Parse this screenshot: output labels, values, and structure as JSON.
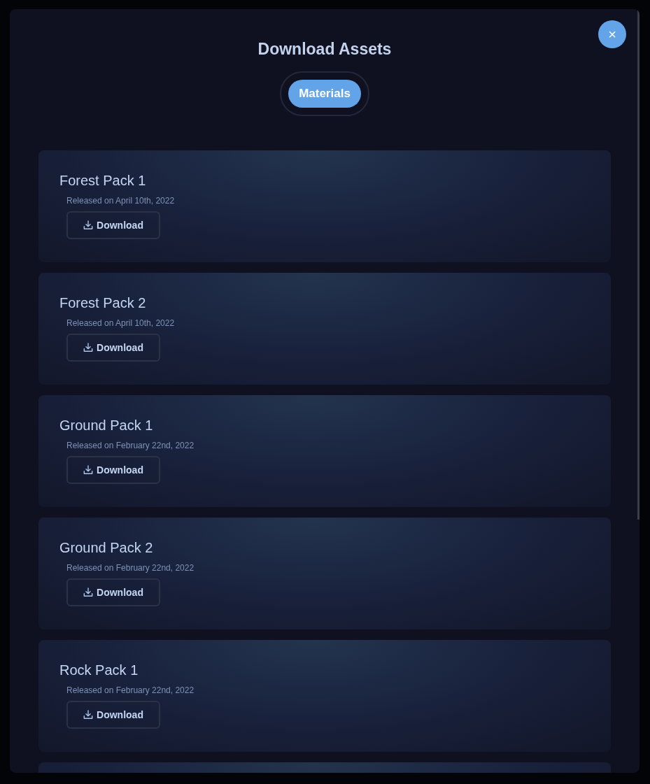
{
  "dialog": {
    "title": "Download Assets",
    "close_icon": "×"
  },
  "tabs": [
    {
      "label": "Materials",
      "selected": true
    }
  ],
  "packs": [
    {
      "name": "Forest Pack 1",
      "released": "Released on April 10th, 2022",
      "button": "Download"
    },
    {
      "name": "Forest Pack 2",
      "released": "Released on April 10th, 2022",
      "button": "Download"
    },
    {
      "name": "Ground Pack 1",
      "released": "Released on February 22nd, 2022",
      "button": "Download"
    },
    {
      "name": "Ground Pack 2",
      "released": "Released on February 22nd, 2022",
      "button": "Download"
    },
    {
      "name": "Rock Pack 1",
      "released": "Released on February 22nd, 2022",
      "button": "Download"
    }
  ]
}
